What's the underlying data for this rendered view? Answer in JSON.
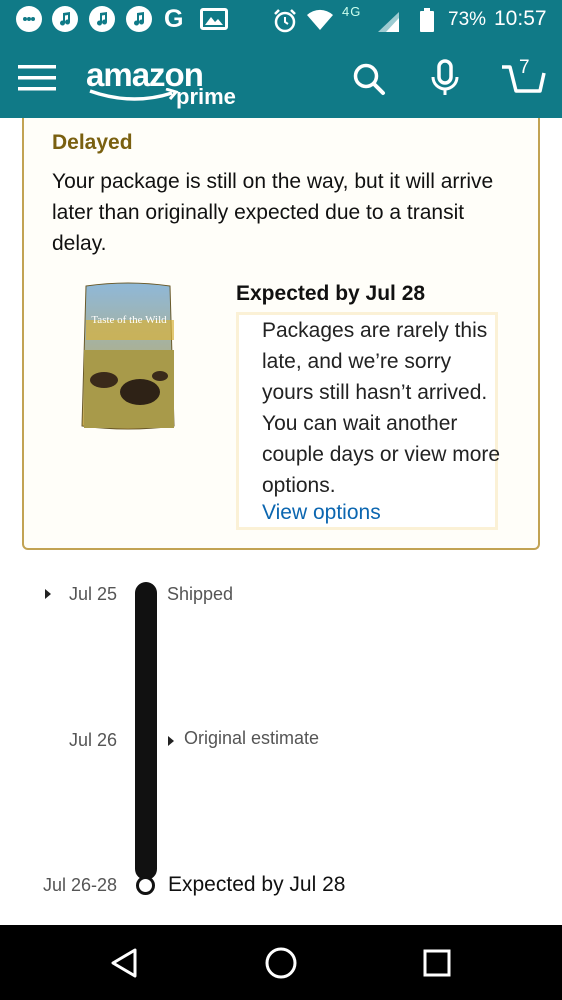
{
  "status_bar": {
    "battery_pct": "73%",
    "time": "10:57",
    "network": "4G",
    "left_icons": [
      "messenger-icon",
      "music-icon",
      "music-icon",
      "music-icon",
      "google-icon",
      "gallery-icon"
    ]
  },
  "header": {
    "logo": "amazon",
    "logo_sub": "prime",
    "cart_count": "7"
  },
  "delay_card": {
    "title": "Delayed",
    "message": "Your package is still on the way, but it will arrive later than originally expected due to a transit delay.",
    "expected_heading": "Expected by Jul 28",
    "info_text": "Packages are rarely this late, and we’re sorry yours still hasn’t arrived. You can wait another couple days or view more options.",
    "link_label": "View options",
    "product_brand": "Taste of the Wild"
  },
  "timeline": {
    "events": [
      {
        "date": "Jul 25",
        "label": "Shipped"
      },
      {
        "date": "Jul 26",
        "label": "Original estimate"
      },
      {
        "date": "Jul 26-28",
        "label": "Expected by Jul 28"
      }
    ]
  },
  "colors": {
    "header_bg": "#107a87",
    "card_border": "#c2a353",
    "delay_title": "#7a6010",
    "link": "#0b66b0"
  }
}
